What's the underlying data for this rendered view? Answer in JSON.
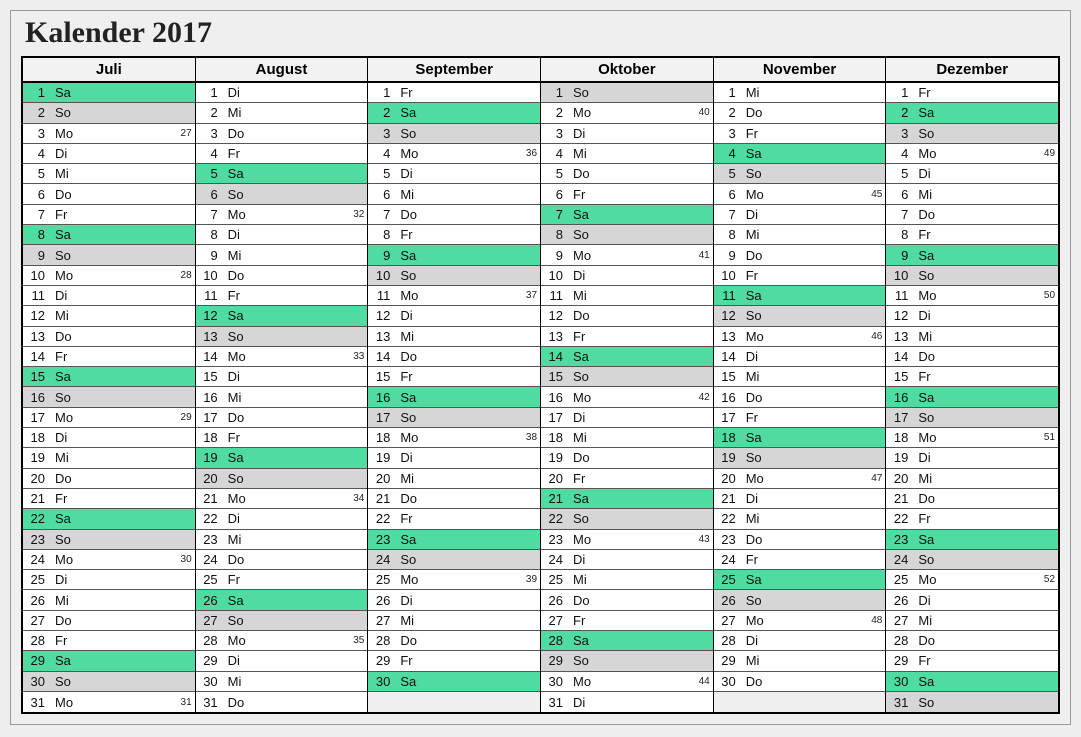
{
  "title": "Kalender 2017",
  "weekdays": [
    "Mo",
    "Di",
    "Mi",
    "Do",
    "Fr",
    "Sa",
    "So"
  ],
  "colors": {
    "saturday": "#50dca0",
    "sunday": "#d6d6d6"
  },
  "months": [
    {
      "name": "Juli",
      "days": [
        {
          "n": 1,
          "w": "Sa"
        },
        {
          "n": 2,
          "w": "So"
        },
        {
          "n": 3,
          "w": "Mo",
          "wk": 27
        },
        {
          "n": 4,
          "w": "Di"
        },
        {
          "n": 5,
          "w": "Mi"
        },
        {
          "n": 6,
          "w": "Do"
        },
        {
          "n": 7,
          "w": "Fr"
        },
        {
          "n": 8,
          "w": "Sa"
        },
        {
          "n": 9,
          "w": "So"
        },
        {
          "n": 10,
          "w": "Mo",
          "wk": 28
        },
        {
          "n": 11,
          "w": "Di"
        },
        {
          "n": 12,
          "w": "Mi"
        },
        {
          "n": 13,
          "w": "Do"
        },
        {
          "n": 14,
          "w": "Fr"
        },
        {
          "n": 15,
          "w": "Sa"
        },
        {
          "n": 16,
          "w": "So"
        },
        {
          "n": 17,
          "w": "Mo",
          "wk": 29
        },
        {
          "n": 18,
          "w": "Di"
        },
        {
          "n": 19,
          "w": "Mi"
        },
        {
          "n": 20,
          "w": "Do"
        },
        {
          "n": 21,
          "w": "Fr"
        },
        {
          "n": 22,
          "w": "Sa"
        },
        {
          "n": 23,
          "w": "So"
        },
        {
          "n": 24,
          "w": "Mo",
          "wk": 30
        },
        {
          "n": 25,
          "w": "Di"
        },
        {
          "n": 26,
          "w": "Mi"
        },
        {
          "n": 27,
          "w": "Do"
        },
        {
          "n": 28,
          "w": "Fr"
        },
        {
          "n": 29,
          "w": "Sa"
        },
        {
          "n": 30,
          "w": "So"
        },
        {
          "n": 31,
          "w": "Mo",
          "wk": 31
        }
      ]
    },
    {
      "name": "August",
      "days": [
        {
          "n": 1,
          "w": "Di"
        },
        {
          "n": 2,
          "w": "Mi"
        },
        {
          "n": 3,
          "w": "Do"
        },
        {
          "n": 4,
          "w": "Fr"
        },
        {
          "n": 5,
          "w": "Sa"
        },
        {
          "n": 6,
          "w": "So"
        },
        {
          "n": 7,
          "w": "Mo",
          "wk": 32
        },
        {
          "n": 8,
          "w": "Di"
        },
        {
          "n": 9,
          "w": "Mi"
        },
        {
          "n": 10,
          "w": "Do"
        },
        {
          "n": 11,
          "w": "Fr"
        },
        {
          "n": 12,
          "w": "Sa"
        },
        {
          "n": 13,
          "w": "So"
        },
        {
          "n": 14,
          "w": "Mo",
          "wk": 33
        },
        {
          "n": 15,
          "w": "Di"
        },
        {
          "n": 16,
          "w": "Mi"
        },
        {
          "n": 17,
          "w": "Do"
        },
        {
          "n": 18,
          "w": "Fr"
        },
        {
          "n": 19,
          "w": "Sa"
        },
        {
          "n": 20,
          "w": "So"
        },
        {
          "n": 21,
          "w": "Mo",
          "wk": 34
        },
        {
          "n": 22,
          "w": "Di"
        },
        {
          "n": 23,
          "w": "Mi"
        },
        {
          "n": 24,
          "w": "Do"
        },
        {
          "n": 25,
          "w": "Fr"
        },
        {
          "n": 26,
          "w": "Sa"
        },
        {
          "n": 27,
          "w": "So"
        },
        {
          "n": 28,
          "w": "Mo",
          "wk": 35
        },
        {
          "n": 29,
          "w": "Di"
        },
        {
          "n": 30,
          "w": "Mi"
        },
        {
          "n": 31,
          "w": "Do"
        }
      ]
    },
    {
      "name": "September",
      "days": [
        {
          "n": 1,
          "w": "Fr"
        },
        {
          "n": 2,
          "w": "Sa"
        },
        {
          "n": 3,
          "w": "So"
        },
        {
          "n": 4,
          "w": "Mo",
          "wk": 36
        },
        {
          "n": 5,
          "w": "Di"
        },
        {
          "n": 6,
          "w": "Mi"
        },
        {
          "n": 7,
          "w": "Do"
        },
        {
          "n": 8,
          "w": "Fr"
        },
        {
          "n": 9,
          "w": "Sa"
        },
        {
          "n": 10,
          "w": "So"
        },
        {
          "n": 11,
          "w": "Mo",
          "wk": 37
        },
        {
          "n": 12,
          "w": "Di"
        },
        {
          "n": 13,
          "w": "Mi"
        },
        {
          "n": 14,
          "w": "Do"
        },
        {
          "n": 15,
          "w": "Fr"
        },
        {
          "n": 16,
          "w": "Sa"
        },
        {
          "n": 17,
          "w": "So"
        },
        {
          "n": 18,
          "w": "Mo",
          "wk": 38
        },
        {
          "n": 19,
          "w": "Di"
        },
        {
          "n": 20,
          "w": "Mi"
        },
        {
          "n": 21,
          "w": "Do"
        },
        {
          "n": 22,
          "w": "Fr"
        },
        {
          "n": 23,
          "w": "Sa"
        },
        {
          "n": 24,
          "w": "So"
        },
        {
          "n": 25,
          "w": "Mo",
          "wk": 39
        },
        {
          "n": 26,
          "w": "Di"
        },
        {
          "n": 27,
          "w": "Mi"
        },
        {
          "n": 28,
          "w": "Do"
        },
        {
          "n": 29,
          "w": "Fr"
        },
        {
          "n": 30,
          "w": "Sa"
        }
      ]
    },
    {
      "name": "Oktober",
      "days": [
        {
          "n": 1,
          "w": "So"
        },
        {
          "n": 2,
          "w": "Mo",
          "wk": 40
        },
        {
          "n": 3,
          "w": "Di"
        },
        {
          "n": 4,
          "w": "Mi"
        },
        {
          "n": 5,
          "w": "Do"
        },
        {
          "n": 6,
          "w": "Fr"
        },
        {
          "n": 7,
          "w": "Sa"
        },
        {
          "n": 8,
          "w": "So"
        },
        {
          "n": 9,
          "w": "Mo",
          "wk": 41
        },
        {
          "n": 10,
          "w": "Di"
        },
        {
          "n": 11,
          "w": "Mi"
        },
        {
          "n": 12,
          "w": "Do"
        },
        {
          "n": 13,
          "w": "Fr"
        },
        {
          "n": 14,
          "w": "Sa"
        },
        {
          "n": 15,
          "w": "So"
        },
        {
          "n": 16,
          "w": "Mo",
          "wk": 42
        },
        {
          "n": 17,
          "w": "Di"
        },
        {
          "n": 18,
          "w": "Mi"
        },
        {
          "n": 19,
          "w": "Do"
        },
        {
          "n": 20,
          "w": "Fr"
        },
        {
          "n": 21,
          "w": "Sa"
        },
        {
          "n": 22,
          "w": "So"
        },
        {
          "n": 23,
          "w": "Mo",
          "wk": 43
        },
        {
          "n": 24,
          "w": "Di"
        },
        {
          "n": 25,
          "w": "Mi"
        },
        {
          "n": 26,
          "w": "Do"
        },
        {
          "n": 27,
          "w": "Fr"
        },
        {
          "n": 28,
          "w": "Sa"
        },
        {
          "n": 29,
          "w": "So"
        },
        {
          "n": 30,
          "w": "Mo",
          "wk": 44
        },
        {
          "n": 31,
          "w": "Di"
        }
      ]
    },
    {
      "name": "November",
      "days": [
        {
          "n": 1,
          "w": "Mi"
        },
        {
          "n": 2,
          "w": "Do"
        },
        {
          "n": 3,
          "w": "Fr"
        },
        {
          "n": 4,
          "w": "Sa"
        },
        {
          "n": 5,
          "w": "So"
        },
        {
          "n": 6,
          "w": "Mo",
          "wk": 45
        },
        {
          "n": 7,
          "w": "Di"
        },
        {
          "n": 8,
          "w": "Mi"
        },
        {
          "n": 9,
          "w": "Do"
        },
        {
          "n": 10,
          "w": "Fr"
        },
        {
          "n": 11,
          "w": "Sa"
        },
        {
          "n": 12,
          "w": "So"
        },
        {
          "n": 13,
          "w": "Mo",
          "wk": 46
        },
        {
          "n": 14,
          "w": "Di"
        },
        {
          "n": 15,
          "w": "Mi"
        },
        {
          "n": 16,
          "w": "Do"
        },
        {
          "n": 17,
          "w": "Fr"
        },
        {
          "n": 18,
          "w": "Sa"
        },
        {
          "n": 19,
          "w": "So"
        },
        {
          "n": 20,
          "w": "Mo",
          "wk": 47
        },
        {
          "n": 21,
          "w": "Di"
        },
        {
          "n": 22,
          "w": "Mi"
        },
        {
          "n": 23,
          "w": "Do"
        },
        {
          "n": 24,
          "w": "Fr"
        },
        {
          "n": 25,
          "w": "Sa"
        },
        {
          "n": 26,
          "w": "So"
        },
        {
          "n": 27,
          "w": "Mo",
          "wk": 48
        },
        {
          "n": 28,
          "w": "Di"
        },
        {
          "n": 29,
          "w": "Mi"
        },
        {
          "n": 30,
          "w": "Do"
        }
      ]
    },
    {
      "name": "Dezember",
      "days": [
        {
          "n": 1,
          "w": "Fr"
        },
        {
          "n": 2,
          "w": "Sa"
        },
        {
          "n": 3,
          "w": "So"
        },
        {
          "n": 4,
          "w": "Mo",
          "wk": 49
        },
        {
          "n": 5,
          "w": "Di"
        },
        {
          "n": 6,
          "w": "Mi"
        },
        {
          "n": 7,
          "w": "Do"
        },
        {
          "n": 8,
          "w": "Fr"
        },
        {
          "n": 9,
          "w": "Sa"
        },
        {
          "n": 10,
          "w": "So"
        },
        {
          "n": 11,
          "w": "Mo",
          "wk": 50
        },
        {
          "n": 12,
          "w": "Di"
        },
        {
          "n": 13,
          "w": "Mi"
        },
        {
          "n": 14,
          "w": "Do"
        },
        {
          "n": 15,
          "w": "Fr"
        },
        {
          "n": 16,
          "w": "Sa"
        },
        {
          "n": 17,
          "w": "So"
        },
        {
          "n": 18,
          "w": "Mo",
          "wk": 51
        },
        {
          "n": 19,
          "w": "Di"
        },
        {
          "n": 20,
          "w": "Mi"
        },
        {
          "n": 21,
          "w": "Do"
        },
        {
          "n": 22,
          "w": "Fr"
        },
        {
          "n": 23,
          "w": "Sa"
        },
        {
          "n": 24,
          "w": "So"
        },
        {
          "n": 25,
          "w": "Mo",
          "wk": 52
        },
        {
          "n": 26,
          "w": "Di"
        },
        {
          "n": 27,
          "w": "Mi"
        },
        {
          "n": 28,
          "w": "Do"
        },
        {
          "n": 29,
          "w": "Fr"
        },
        {
          "n": 30,
          "w": "Sa"
        },
        {
          "n": 31,
          "w": "So"
        }
      ]
    }
  ]
}
